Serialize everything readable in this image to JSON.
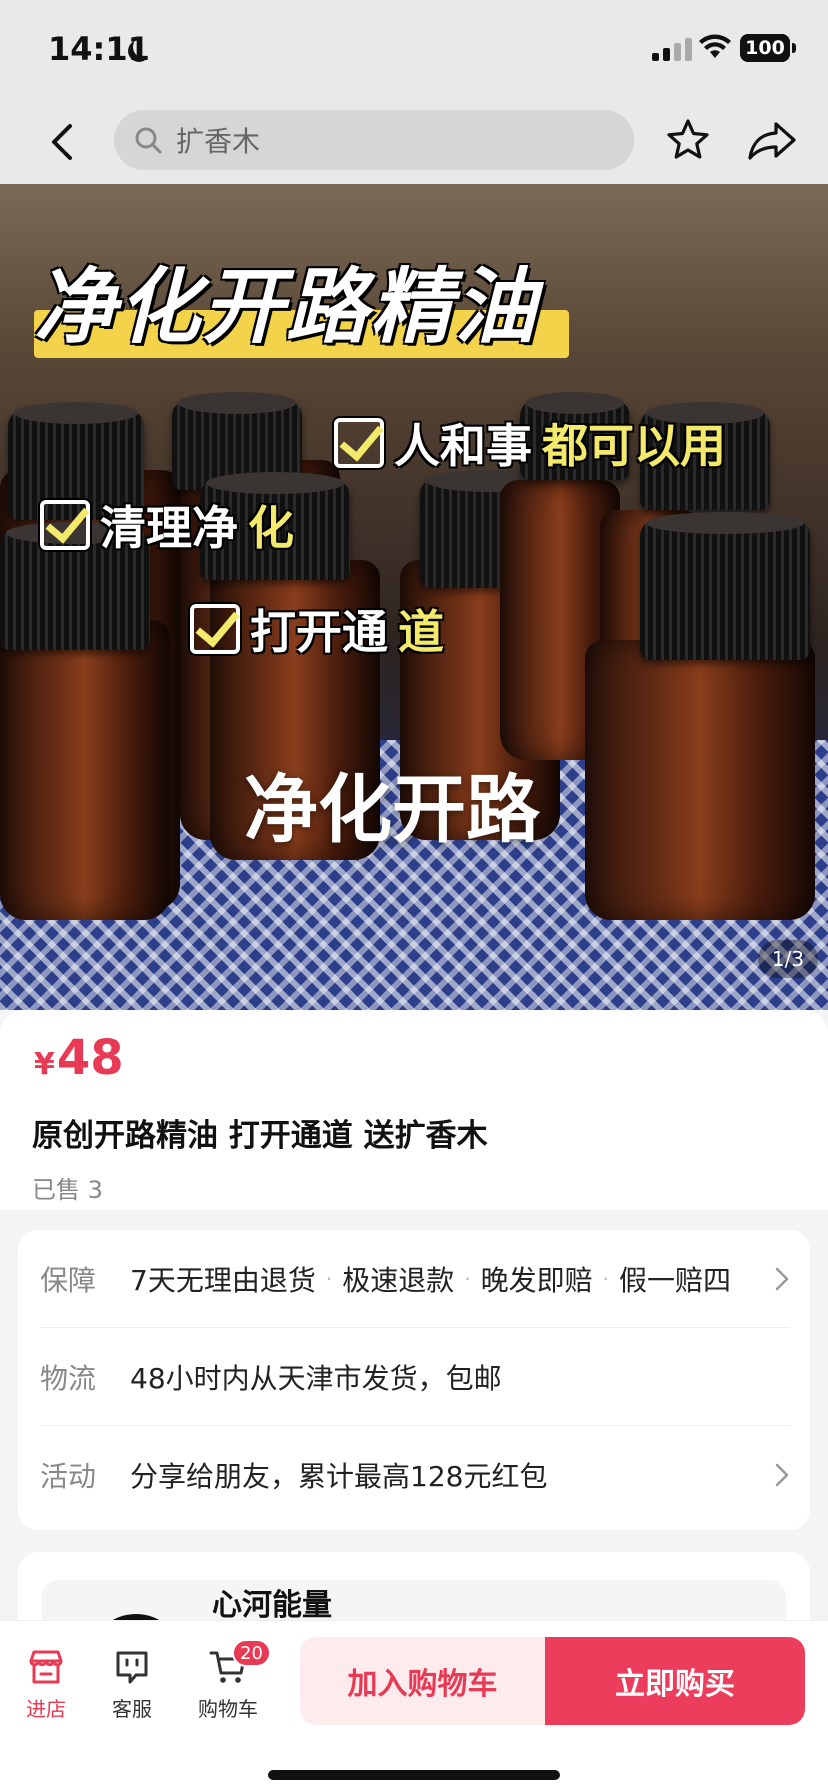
{
  "status_bar": {
    "time": "14:11",
    "battery": "100"
  },
  "nav": {
    "search_placeholder": "扩香木",
    "icons": [
      "back-arrow-icon",
      "search-icon",
      "star-icon",
      "share-icon"
    ]
  },
  "hero": {
    "title": "净化开路精油",
    "checks": [
      {
        "text": "人和事",
        "highlight": "都可以用"
      },
      {
        "text": "清理净",
        "highlight": "化"
      },
      {
        "text": "打开通",
        "highlight": "道"
      }
    ],
    "caption": "净化开路",
    "pager": "1/3"
  },
  "product": {
    "currency": "¥",
    "price": "48",
    "title": "原创开路精油 打开通道 送扩香木",
    "sold": "已售 3"
  },
  "service": {
    "guarantee_label": "保障",
    "guarantee_items": [
      "7天无理由退货",
      "极速退款",
      "晚发即赔",
      "假一赔四"
    ],
    "shipping_label": "物流",
    "shipping_value": "48小时内从天津市发货，包邮",
    "promo_label": "活动",
    "promo_value": "分享给朋友，累计最高128元红包"
  },
  "shop": {
    "name": "心河能量"
  },
  "bottom_bar": {
    "store_label": "进店",
    "service_label": "客服",
    "cart_label": "购物车",
    "cart_count": "20",
    "add_to_cart": "加入购物车",
    "buy_now": "立即购买"
  },
  "colors": {
    "accent": "#e83a55",
    "cart_button_bg": "#fdebed",
    "highlight_yellow": "#f3d34a"
  }
}
